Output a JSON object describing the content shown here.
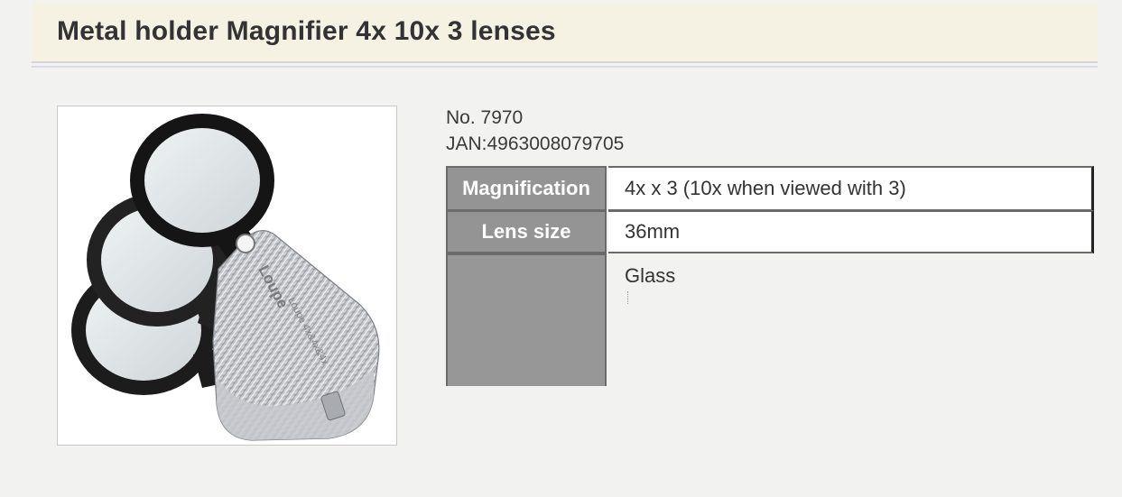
{
  "product": {
    "title": "Metal holder Magnifier 4x 10x 3 lenses",
    "number": "No. 7970",
    "jan": "JAN:4963008079705",
    "image_icon": "folding-loupe-magnifier-photo",
    "image_engraving": "Loupe 4x&4x&4x"
  },
  "specs": [
    {
      "label": "Magnification",
      "value": "4x x 3 (10x when viewed with 3)"
    },
    {
      "label": "Lens size",
      "value": "36mm"
    },
    {
      "label": "",
      "value": "Glass"
    }
  ],
  "colors": {
    "header_bg": "#f5f1e3",
    "page_bg": "#f2f2f0",
    "table_header_bg": "#949494"
  }
}
